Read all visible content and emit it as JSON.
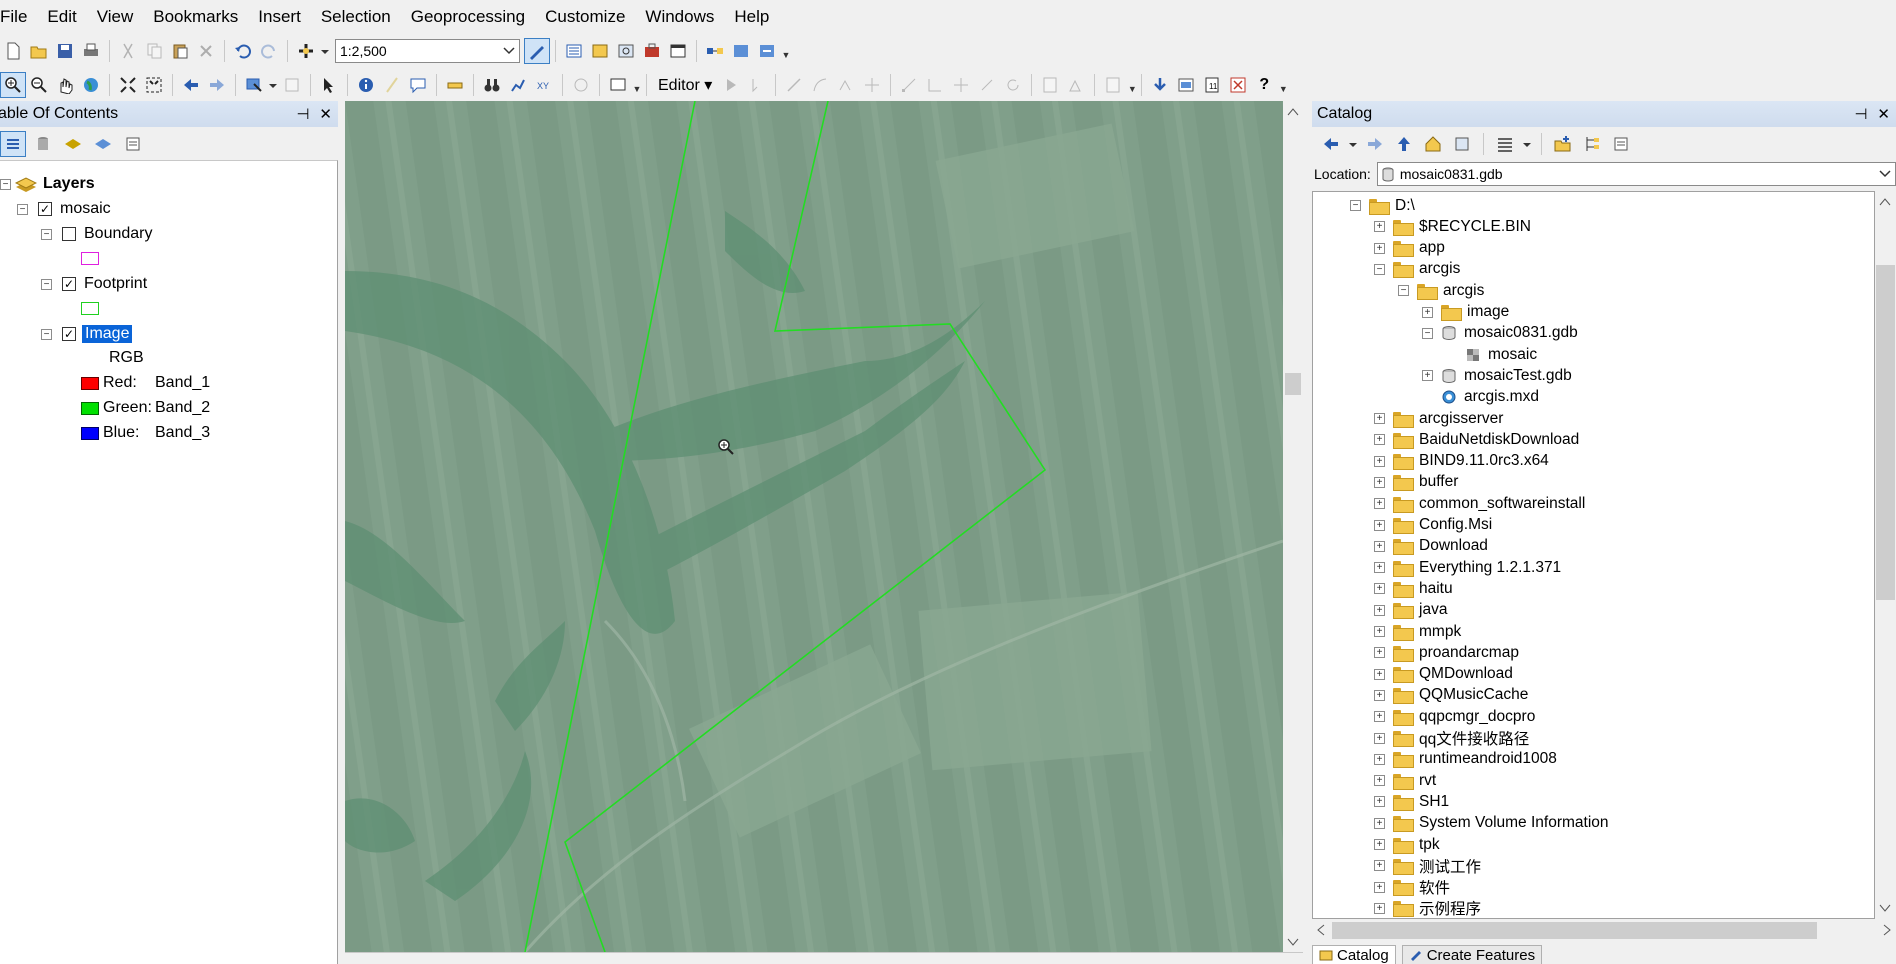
{
  "menu": [
    "File",
    "Edit",
    "View",
    "Bookmarks",
    "Insert",
    "Selection",
    "Geoprocessing",
    "Customize",
    "Windows",
    "Help"
  ],
  "toolbar": {
    "scale": "1:2,500",
    "editor_label": "Editor",
    "help_icon": "?"
  },
  "toc": {
    "title": "Table Of Contents",
    "layers_label": "Layers",
    "group": "mosaic",
    "boundary": "Boundary",
    "footprint": "Footprint",
    "image": "Image",
    "rgb": "RGB",
    "bands": [
      {
        "name": "Red:",
        "band": "Band_1",
        "color": "#ff0000"
      },
      {
        "name": "Green:",
        "band": "Band_2",
        "color": "#00e000"
      },
      {
        "name": "Blue:",
        "band": "Band_3",
        "color": "#0000ff"
      }
    ],
    "boundary_symbol_color": "#e020e0",
    "footprint_symbol_color": "#20d020",
    "visibility": {
      "mosaic": true,
      "boundary": false,
      "footprint": true,
      "image": true
    }
  },
  "catalog": {
    "title": "Catalog",
    "location_label": "Location:",
    "location_value": "mosaic0831.gdb",
    "tree": [
      {
        "label": "D:\\",
        "level": 0,
        "type": "drive",
        "exp": "-"
      },
      {
        "label": "$RECYCLE.BIN",
        "level": 1,
        "type": "folder",
        "exp": "+"
      },
      {
        "label": "app",
        "level": 1,
        "type": "folder",
        "exp": "+"
      },
      {
        "label": "arcgis",
        "level": 1,
        "type": "folder",
        "exp": "-"
      },
      {
        "label": "arcgis",
        "level": 2,
        "type": "folder",
        "exp": "-"
      },
      {
        "label": "image",
        "level": 3,
        "type": "folder",
        "exp": "+"
      },
      {
        "label": "mosaic0831.gdb",
        "level": 3,
        "type": "gdb",
        "exp": "-"
      },
      {
        "label": "mosaic",
        "level": 4,
        "type": "mosaic",
        "exp": ""
      },
      {
        "label": "mosaicTest.gdb",
        "level": 3,
        "type": "gdb",
        "exp": "+"
      },
      {
        "label": "arcgis.mxd",
        "level": 3,
        "type": "mxd",
        "exp": ""
      },
      {
        "label": "arcgisserver",
        "level": 1,
        "type": "folder",
        "exp": "+"
      },
      {
        "label": "BaiduNetdiskDownload",
        "level": 1,
        "type": "folder",
        "exp": "+"
      },
      {
        "label": "BIND9.11.0rc3.x64",
        "level": 1,
        "type": "folder",
        "exp": "+"
      },
      {
        "label": "buffer",
        "level": 1,
        "type": "folder",
        "exp": "+"
      },
      {
        "label": "common_softwareinstall",
        "level": 1,
        "type": "folder",
        "exp": "+"
      },
      {
        "label": "Config.Msi",
        "level": 1,
        "type": "folder",
        "exp": "+"
      },
      {
        "label": "Download",
        "level": 1,
        "type": "folder",
        "exp": "+"
      },
      {
        "label": "Everything 1.2.1.371",
        "level": 1,
        "type": "folder",
        "exp": "+"
      },
      {
        "label": "haitu",
        "level": 1,
        "type": "folder",
        "exp": "+"
      },
      {
        "label": "java",
        "level": 1,
        "type": "folder",
        "exp": "+"
      },
      {
        "label": "mmpk",
        "level": 1,
        "type": "folder",
        "exp": "+"
      },
      {
        "label": "proandarcmap",
        "level": 1,
        "type": "folder",
        "exp": "+"
      },
      {
        "label": "QMDownload",
        "level": 1,
        "type": "folder",
        "exp": "+"
      },
      {
        "label": "QQMusicCache",
        "level": 1,
        "type": "folder",
        "exp": "+"
      },
      {
        "label": "qqpcmgr_docpro",
        "level": 1,
        "type": "folder",
        "exp": "+"
      },
      {
        "label": "qq文件接收路径",
        "level": 1,
        "type": "folder",
        "exp": "+"
      },
      {
        "label": "runtimeandroid1008",
        "level": 1,
        "type": "folder",
        "exp": "+"
      },
      {
        "label": "rvt",
        "level": 1,
        "type": "folder",
        "exp": "+"
      },
      {
        "label": "SH1",
        "level": 1,
        "type": "folder",
        "exp": "+"
      },
      {
        "label": "System Volume Information",
        "level": 1,
        "type": "folder",
        "exp": "+"
      },
      {
        "label": "tpk",
        "level": 1,
        "type": "folder",
        "exp": "+"
      },
      {
        "label": "测试工作",
        "level": 1,
        "type": "folder",
        "exp": "+"
      },
      {
        "label": "软件",
        "level": 1,
        "type": "folder",
        "exp": "+"
      },
      {
        "label": "示例程序",
        "level": 1,
        "type": "folder",
        "exp": "+"
      }
    ],
    "tabs": [
      "Catalog",
      "Create Features"
    ]
  },
  "colors": {
    "map_background": "#7c9c86",
    "footprint_line": "#22dd22",
    "selection": "#0a64d8",
    "panel_header": "#d5e1f1"
  }
}
